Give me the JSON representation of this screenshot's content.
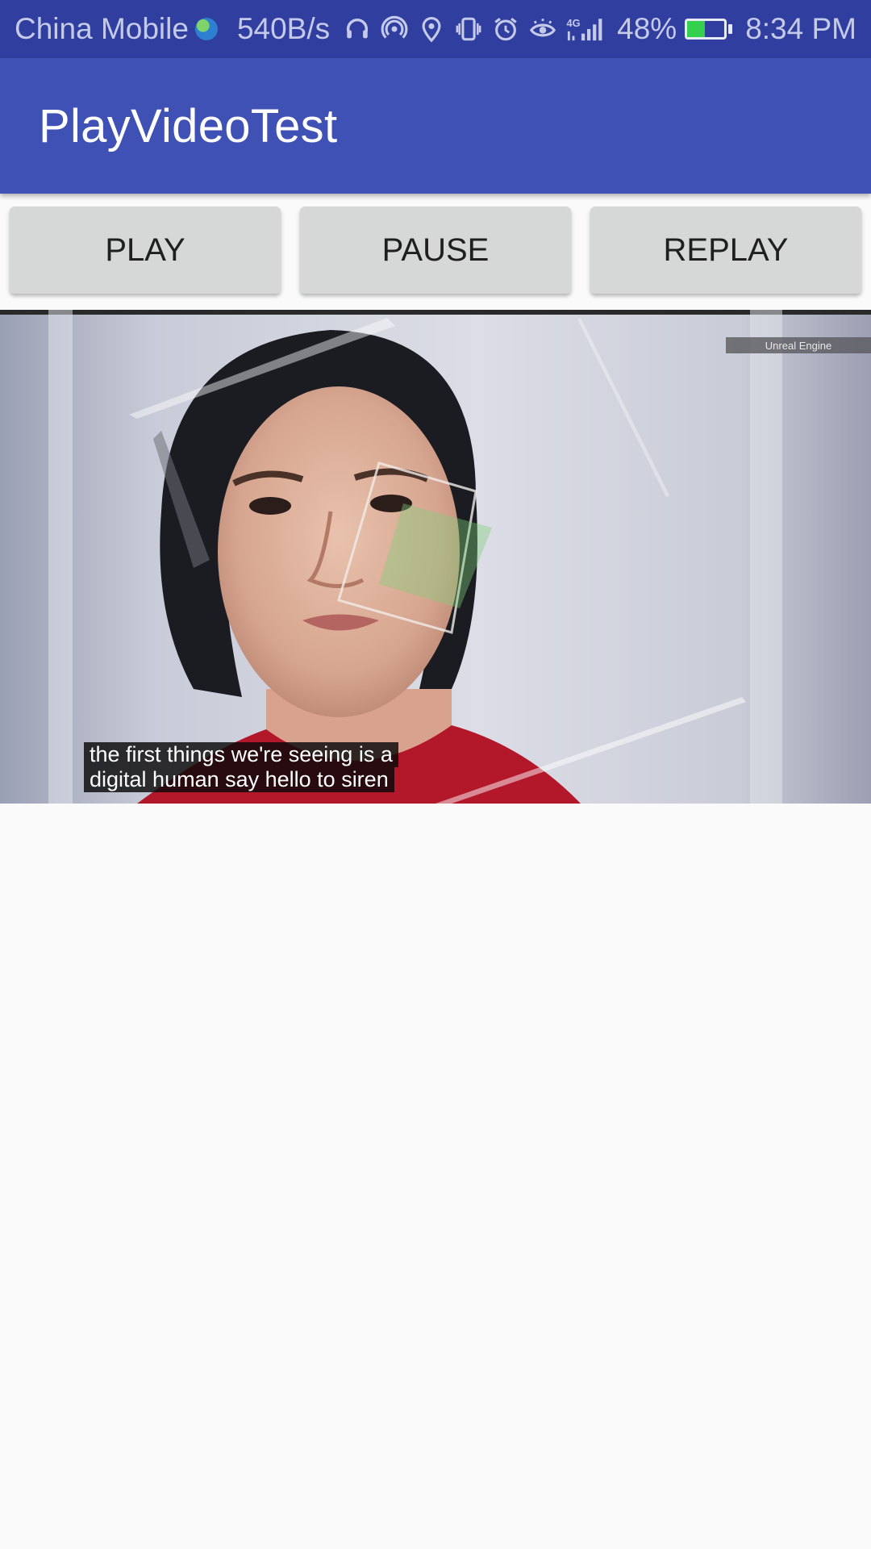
{
  "status_bar": {
    "carrier": "China Mobile",
    "net_speed": "540B/s",
    "network_type": "4G",
    "battery_percent": "48%",
    "battery_level": 0.48,
    "time": "8:34 PM",
    "icons": [
      "globe-icon",
      "headphones-icon",
      "hotspot-icon",
      "location-icon",
      "vibrate-icon",
      "alarm-icon",
      "eye-icon",
      "signal-icon",
      "battery-icon"
    ]
  },
  "app_bar": {
    "title": "PlayVideoTest"
  },
  "buttons": {
    "play": "PLAY",
    "pause": "PAUSE",
    "replay": "REPLAY"
  },
  "video": {
    "watermark": "Unreal Engine",
    "captions": [
      "the first things we're seeing is a",
      "digital human say hello to siren"
    ]
  },
  "colors": {
    "status_bar": "#303f9f",
    "app_bar": "#3f51b5",
    "button": "#d6d7d7",
    "background": "#fafafa"
  }
}
